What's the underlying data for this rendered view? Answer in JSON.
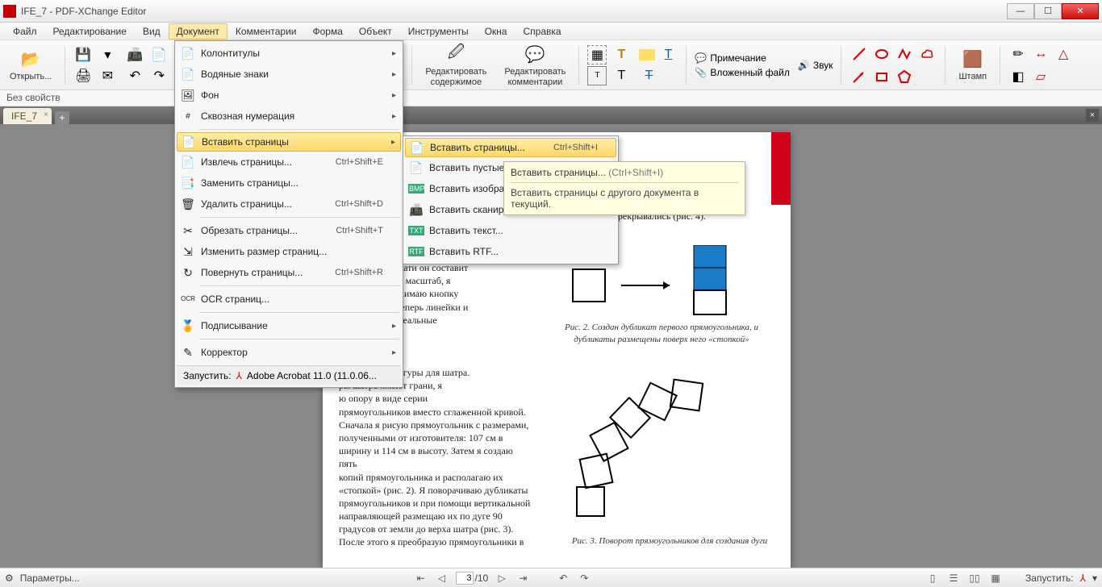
{
  "window": {
    "title": "IFE_7 - PDF-XChange Editor"
  },
  "menubar": [
    "Файл",
    "Редактирование",
    "Вид",
    "Документ",
    "Комментарии",
    "Форма",
    "Объект",
    "Инструменты",
    "Окна",
    "Справка"
  ],
  "menubar_active_index": 3,
  "toolbar": {
    "open": "Открыть...",
    "edit_content": "Редактировать\nсодержимое",
    "edit_comments": "Редактировать\nкомментарии",
    "note": "Примечание",
    "sound": "Звук",
    "attach": "Вложенный файл",
    "stamp": "Штамп"
  },
  "properties_bar": "Без свойств",
  "tab": {
    "name": "IFE_7"
  },
  "document_menu": {
    "items": [
      {
        "label": "Колонтитулы",
        "icon": "📄",
        "arrow": true
      },
      {
        "label": "Водяные знаки",
        "icon": "📄",
        "arrow": true
      },
      {
        "label": "Фон",
        "icon": "🖼",
        "arrow": true
      },
      {
        "label": "Сквозная нумерация",
        "icon": "#",
        "arrow": true
      },
      {
        "sep": true
      },
      {
        "label": "Вставить страницы",
        "icon": "📄",
        "arrow": true,
        "hover": true
      },
      {
        "label": "Извлечь страницы...",
        "icon": "📄",
        "short": "Ctrl+Shift+E"
      },
      {
        "label": "Заменить страницы...",
        "icon": "📑"
      },
      {
        "label": "Удалить страницы...",
        "icon": "🗑",
        "short": "Ctrl+Shift+D"
      },
      {
        "sep": true
      },
      {
        "label": "Обрезать страницы...",
        "icon": "✂",
        "short": "Ctrl+Shift+T"
      },
      {
        "label": "Изменить размер страниц...",
        "icon": "⇲"
      },
      {
        "label": "Повернуть страницы...",
        "icon": "↻",
        "short": "Ctrl+Shift+R"
      },
      {
        "sep": true
      },
      {
        "label": "OCR страниц...",
        "icon": "OCR"
      },
      {
        "sep": true
      },
      {
        "label": "Подписывание",
        "icon": "🏅",
        "arrow": true
      },
      {
        "sep": true
      },
      {
        "label": "Корректор",
        "icon": "✎",
        "arrow": true
      }
    ],
    "footer": "Запустить:",
    "footer_app": "Adobe Acrobat 11.0 (11.0.06..."
  },
  "insert_submenu": {
    "items": [
      {
        "label": "Вставить страницы...",
        "icon": "📄",
        "short": "Ctrl+Shift+I",
        "hover": true
      },
      {
        "label": "Вставить пустые страницы...",
        "icon": "📄"
      },
      {
        "label": "Вставить изображения...",
        "icon": "🖼"
      },
      {
        "label": "Вставить сканированные страницы...",
        "icon": "📠"
      },
      {
        "label": "Вставить текст...",
        "icon": "TXT"
      },
      {
        "label": "Вставить RTF...",
        "icon": "RTF"
      }
    ]
  },
  "tooltip": {
    "title": "Вставить страницы...",
    "hotkey": "(Ctrl+Shift+I)",
    "body": "Вставить страницы с другого документа в текущий."
  },
  "page_text": {
    "p1": "угольников так, чтобы\nи не перекрывались (рис. 4).",
    "p2": "ране или на печати он составит\nв. Чтобы задать масштаб, я\nю линейки, нажимаю кнопку\nибираю 1:10. Теперь линейки и\nи показывают реальные",
    "cap2": "Рис. 2. Создан дубликат первого прямоугольника, и\nдубликаты размещены поверх него «стопкой»",
    "p3": "о векторные фигуры для шатра.\nры шатра имеют грани, я\nю опору в виде серии\nпрямоугольников вместо сглаженной кривой.\nСначала я рисую прямоугольник с размерами,\nполученными от изготовителя: 107 см в\nширину и 114 см в высоту. Затем я создаю пять\nкопий прямоугольника и располагаю их\n«стопкой» (рис. 2). Я поворачиваю дубликаты\nпрямоугольников и при помощи вертикальной\nнаправляющей размещаю их по дуге 90\nградусов от земли до верха шатра (рис. 3).\nПосле этого я преобразую прямоугольники в",
    "cap3": "Рис. 3. Поворот прямоугольников для создания дуги"
  },
  "statusbar": {
    "options": "Параметры...",
    "page_current": "3",
    "page_total": "/10",
    "launch": "Запустить:"
  }
}
